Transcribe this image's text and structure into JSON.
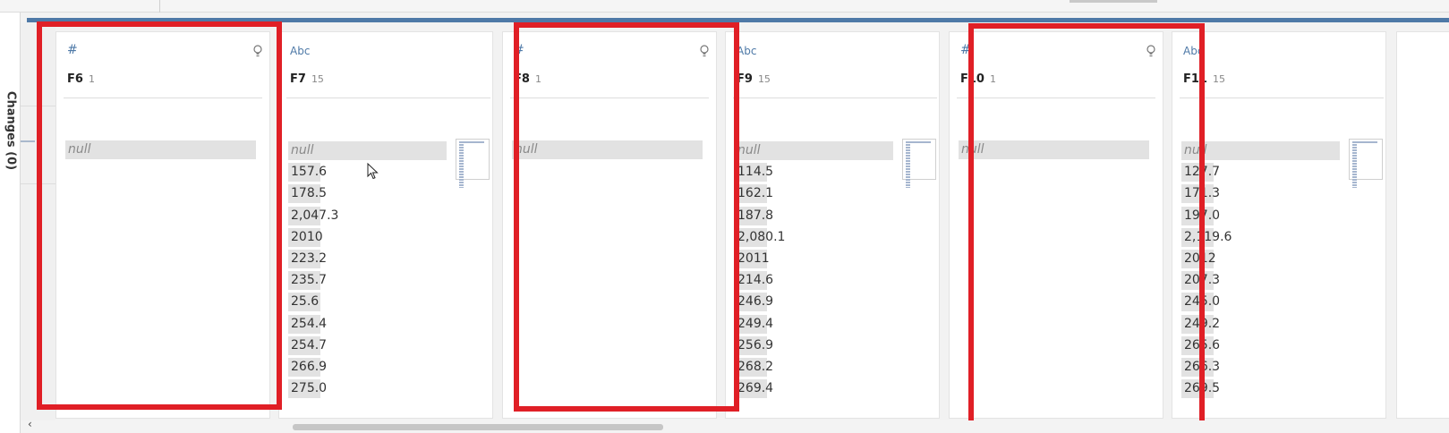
{
  "left_rail": {
    "label": "Changes (0)"
  },
  "columns": [
    {
      "id": "F6",
      "type_icon": "number-hash-icon",
      "type_glyph": "#",
      "name": "F6",
      "count": "1",
      "has_recommendation": true,
      "values": [
        "null"
      ]
    },
    {
      "id": "F7",
      "type_icon": "string-abc-icon",
      "type_glyph": "Abc",
      "name": "F7",
      "count": "15",
      "has_recommendation": false,
      "values": [
        "null",
        "157.6",
        "178.5",
        "2,047.3",
        "2010",
        "223.2",
        "235.7",
        "25.6",
        "254.4",
        "254.7",
        "266.9",
        "275.0"
      ]
    },
    {
      "id": "F8",
      "type_icon": "number-hash-icon",
      "type_glyph": "#",
      "name": "F8",
      "count": "1",
      "has_recommendation": true,
      "values": [
        "null"
      ]
    },
    {
      "id": "F9",
      "type_icon": "string-abc-icon",
      "type_glyph": "Abc",
      "name": "F9",
      "count": "15",
      "has_recommendation": false,
      "values": [
        "null",
        "114.5",
        "162.1",
        "187.8",
        "2,080.1",
        "2011",
        "214.6",
        "246.9",
        "249.4",
        "256.9",
        "268.2",
        "269.4"
      ]
    },
    {
      "id": "F10",
      "type_icon": "number-hash-icon",
      "type_glyph": "#",
      "name": "F10",
      "count": "1",
      "has_recommendation": true,
      "values": [
        "null"
      ]
    },
    {
      "id": "F11",
      "type_icon": "string-abc-icon",
      "type_glyph": "Abc",
      "name": "F11",
      "count": "15",
      "has_recommendation": false,
      "values": [
        "null",
        "127.7",
        "171.3",
        "197.0",
        "2,119.6",
        "2012",
        "207.3",
        "245.0",
        "249.2",
        "265.6",
        "266.3",
        "269.5"
      ]
    }
  ],
  "colors": {
    "accent": "#4e79a7",
    "highlight_box": "#e01f26",
    "value_fill": "#e2e2e2"
  }
}
